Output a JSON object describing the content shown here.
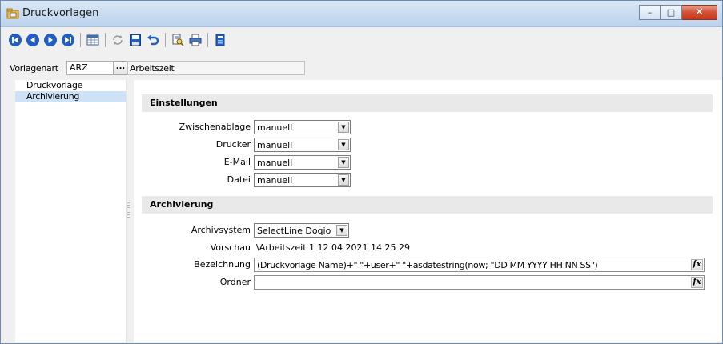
{
  "window": {
    "title": "Druckvorlagen",
    "controls": {
      "minimize": "–",
      "maximize": "□",
      "close": "✕"
    }
  },
  "toolbar": {
    "icons": [
      "first-icon",
      "previous-icon",
      "next-icon",
      "last-icon",
      "table-view-icon",
      "refresh-icon",
      "save-icon",
      "undo-icon",
      "print-preview-icon",
      "printer-icon",
      "bookmark-icon"
    ]
  },
  "vorlagenart": {
    "label": "Vorlagenart",
    "value": "ARZ",
    "button": "...",
    "description": "Arbeitszeit"
  },
  "tree": {
    "items": [
      {
        "label": "Druckvorlage",
        "selected": false
      },
      {
        "label": "Archivierung",
        "selected": true
      }
    ]
  },
  "einstellungen": {
    "header": "Einstellungen",
    "fields": [
      {
        "label": "Zwischenablage",
        "value": "manuell"
      },
      {
        "label": "Drucker",
        "value": "manuell"
      },
      {
        "label": "E-Mail",
        "value": "manuell"
      },
      {
        "label": "Datei",
        "value": "manuell"
      }
    ]
  },
  "archivierung": {
    "header": "Archivierung",
    "archivsystem_label": "Archivsystem",
    "archivsystem_value": "SelectLine Doqio",
    "vorschau_label": "Vorschau",
    "vorschau_value": "\\Arbeitszeit  1 12 04 2021 14 25 29",
    "bezeichnung_label": "Bezeichnung",
    "bezeichnung_value": "(Druckvorlage Name)+\" \"+user+\" \"+asdatestring(now; \"DD MM YYYY HH NN SS\")",
    "ordner_label": "Ordner",
    "ordner_value": "",
    "fx_label": "fx"
  },
  "colors": {
    "titlebar": "#c9dcf1",
    "selection": "#cde2f7",
    "section_bg": "#e9e9e9",
    "nav_blue": "#1f5fc4",
    "close_red": "#d4543a"
  }
}
